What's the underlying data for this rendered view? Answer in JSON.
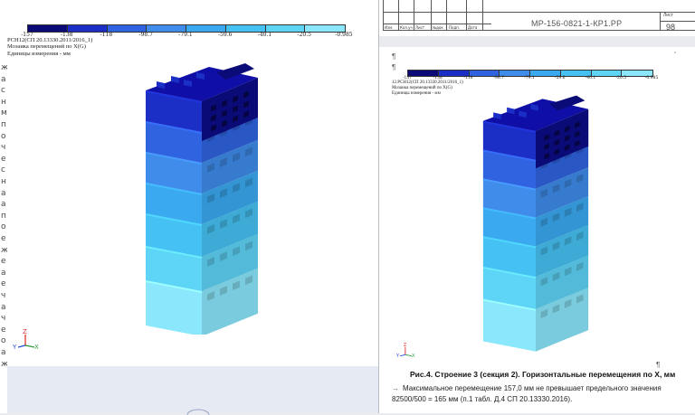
{
  "color_scale": {
    "labels": [
      "-157",
      "-138",
      "-118",
      "-98.7",
      "-79.1",
      "-59.6",
      "-40.1",
      "-20.5",
      "-0.985"
    ],
    "colors": [
      "#0b0b78",
      "#1b2fc7",
      "#2f63df",
      "#3f8ceb",
      "#3aa9f0",
      "#45c2f3",
      "#5ed4f7",
      "#8be7fb"
    ]
  },
  "figure_caption": {
    "line1": "РСН12(СП 20.13330.2011/2016_1)",
    "line2": "Мозаика перемещений по X(G)",
    "line3": "Единицы измерения - мм"
  },
  "figure_caption_small": {
    "line1": "12.РСН12(СП 20.13330.2011/2016_1)",
    "line2": "Мозаика перемещений по X(G)",
    "line3": "Единицы измерения - мм"
  },
  "axes": {
    "x": "X",
    "y": "Y",
    "z": "Z"
  },
  "document": {
    "doc_code": "МР-156-0821-1-КР1.РР",
    "sheet_label": "Лист",
    "sheet_number": "98",
    "header_cells": [
      "Изм.",
      "Кол.уч",
      "Лист",
      "№док",
      "Подп.",
      "Дата"
    ],
    "figure_title": "Рис.4. Строение 3 (секция 2). Горизонтальные перемещения по X, мм",
    "paragraph": "Максимальное перемещение 157,0 мм не превышает предельного значения 82500/500 = 165 мм (п.1 табл. Д.4 СП 20.13330.2016)."
  },
  "left_strip": [
    "ж",
    "а",
    "с",
    "н",
    "м",
    "п",
    "о",
    "ч",
    "е",
    "с",
    "н",
    "а",
    "а",
    "п",
    "о",
    "е",
    "ж",
    "е",
    "а",
    "е",
    "ч",
    "а",
    "ч",
    "е",
    "о",
    "а",
    "ж"
  ]
}
